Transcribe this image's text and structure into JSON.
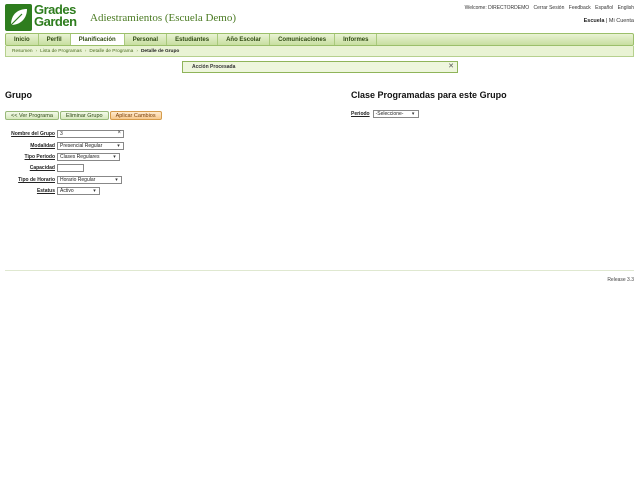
{
  "brand": {
    "logo_line1": "Grades",
    "logo_line2": "Garden",
    "title": "Adiestramientos (Escuela Demo)"
  },
  "top_links": {
    "welcome_prefix": "Welcome: DIRECTORDEMO",
    "logout": "Cerrar Sesión",
    "feedback": "Feedback",
    "spanish": "Español",
    "english": "English"
  },
  "school_links": {
    "school": "Escuela",
    "separator": "|",
    "account": "Mi Cuenta"
  },
  "nav": {
    "items": [
      {
        "label": "Inicio"
      },
      {
        "label": "Perfil"
      },
      {
        "label": "Planificación"
      },
      {
        "label": "Personal"
      },
      {
        "label": "Estudiantes"
      },
      {
        "label": "Año Escolar"
      },
      {
        "label": "Comunicaciones"
      },
      {
        "label": "Informes"
      }
    ],
    "active_index": 2
  },
  "breadcrumb": {
    "items": [
      "Resumen",
      "Lista de Programas",
      "Detalle de Programa"
    ],
    "current": "Detalle de Grupo",
    "separator": "›"
  },
  "message": {
    "text": "Acción Procesada",
    "close": "✕"
  },
  "group": {
    "title": "Grupo",
    "buttons": {
      "view_program": "<< Ver Programa",
      "delete_group": "Eliminar Grupo",
      "apply_changes": "Aplicar Cambios"
    },
    "fields": {
      "name_label": "Nombre del Grupo",
      "name_value": "3",
      "modality_label": "Modalidad",
      "modality_value": "Presencial Regular",
      "period_type_label": "Tipo Periodo",
      "period_type_value": "Clases Regulares",
      "capacity_label": "Capacidad",
      "capacity_value": "",
      "schedule_type_label": "Tipo de Horario",
      "schedule_type_value": "Horario Regular",
      "status_label": "Estatus",
      "status_value": "Activo"
    }
  },
  "scheduled": {
    "title": "Clase Programadas para este Grupo",
    "period_label": "Periodo",
    "period_value": "-Seleccione-"
  },
  "footer": {
    "release": "Release 3.3"
  },
  "colors": {
    "brand_green": "#2e7d1e",
    "nav_bg": "#c7dea0",
    "accent_orange": "#f7c98d"
  }
}
